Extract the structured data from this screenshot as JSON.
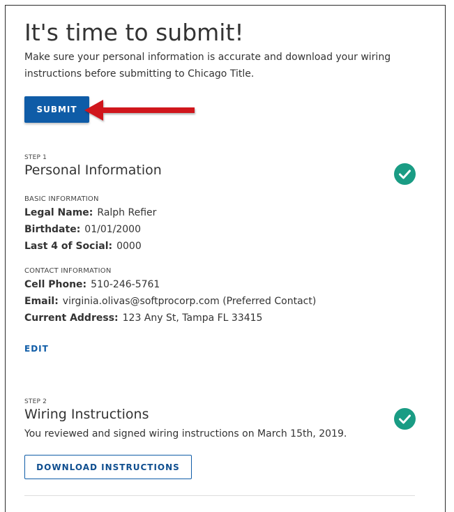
{
  "header": {
    "title": "It's time to submit!",
    "intro": "Make sure your personal information is accurate and download your wiring instructions before submitting to Chicago Title."
  },
  "submit": {
    "label": "SUBMIT"
  },
  "step1": {
    "step_label": "STEP 1",
    "title": "Personal Information",
    "status": "complete",
    "basic": {
      "label": "BASIC INFORMATION",
      "legal_name_key": "Legal Name:",
      "legal_name": "Ralph Refier",
      "birthdate_key": "Birthdate:",
      "birthdate": "01/01/2000",
      "social_key": "Last 4 of Social:",
      "social": "0000"
    },
    "contact": {
      "label": "CONTACT INFORMATION",
      "cell_key": "Cell Phone:",
      "cell": "510-246-5761",
      "email_key": "Email:",
      "email": "virginia.olivas@softprocorp.com (Preferred Contact)",
      "address_key": "Current Address:",
      "address": "123 Any St, Tampa FL 33415"
    },
    "edit_label": "EDIT"
  },
  "step2": {
    "step_label": "STEP 2",
    "title": "Wiring Instructions",
    "status": "complete",
    "reviewed": "You reviewed and signed wiring instructions on March 15th, 2019.",
    "download_label": "DOWNLOAD INSTRUCTIONS"
  },
  "colors": {
    "primary": "#0f5ca7",
    "check": "#1a9c84",
    "arrow": "#d0121b"
  },
  "icons": {
    "step1": "check-circle-icon",
    "step2": "check-circle-icon",
    "pointer": "arrow-left-icon"
  }
}
